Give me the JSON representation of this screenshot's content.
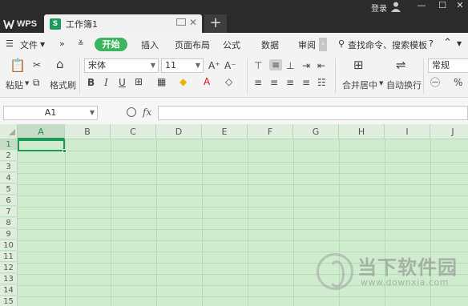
{
  "app": {
    "brand": "WPS",
    "login": "登录"
  },
  "tab": {
    "name": "工作簿1",
    "sheet_glyph": "S"
  },
  "menu": {
    "file": "文件",
    "more": "»",
    "start": "开始",
    "items": [
      "插入",
      "页面布局",
      "公式",
      "数据",
      "审阅"
    ],
    "search": "查找命令、搜索模板",
    "help": "?"
  },
  "ribbon": {
    "paste": "粘贴",
    "format_painter": "格式刷",
    "font_name": "宋体",
    "font_size": "11",
    "bold": "B",
    "italic": "I",
    "underline": "U",
    "font_grow": "A⁺",
    "font_shrink": "A⁻",
    "merge_center": "合并居中",
    "wrap_text": "自动换行",
    "number_format": "常规",
    "percent": "%"
  },
  "formula_bar": {
    "cell_ref": "A1",
    "fx": "fx",
    "value": ""
  },
  "sheet": {
    "columns": [
      "A",
      "B",
      "C",
      "D",
      "E",
      "F",
      "G",
      "H",
      "I",
      "J"
    ],
    "rows": [
      "1",
      "2",
      "3",
      "4",
      "5",
      "6",
      "7",
      "8",
      "9",
      "10",
      "11",
      "12",
      "13",
      "14",
      "15"
    ],
    "active_cell": "A1"
  },
  "watermark": {
    "title": "当下软件园",
    "url": "www.downxia.com"
  },
  "colors": {
    "accent": "#3db460",
    "grid_bg": "#cfeccf",
    "titlebar": "#2b2b2b"
  }
}
